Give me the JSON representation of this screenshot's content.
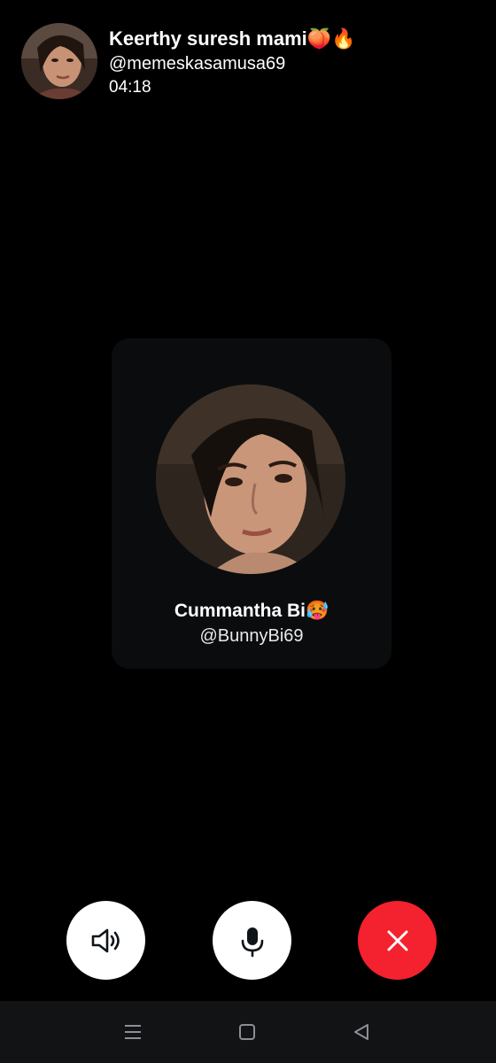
{
  "header": {
    "name": "Keerthy suresh mami🍑🔥",
    "handle": "@memeskasamusa69",
    "timer": "04:18"
  },
  "participant": {
    "name": "Cummantha Bi🥵",
    "handle": "@BunnyBi69"
  },
  "controls": {
    "speaker_icon": "speaker-icon",
    "mic_icon": "microphone-icon",
    "end_icon": "close-icon"
  },
  "nav": {
    "menu_icon": "menu-icon",
    "home_icon": "home-square-icon",
    "back_icon": "back-triangle-icon"
  },
  "colors": {
    "background": "#000000",
    "card": "#0b0c0d",
    "end_call": "#f4212e",
    "control": "#ffffff",
    "nav_bar": "#121314"
  }
}
